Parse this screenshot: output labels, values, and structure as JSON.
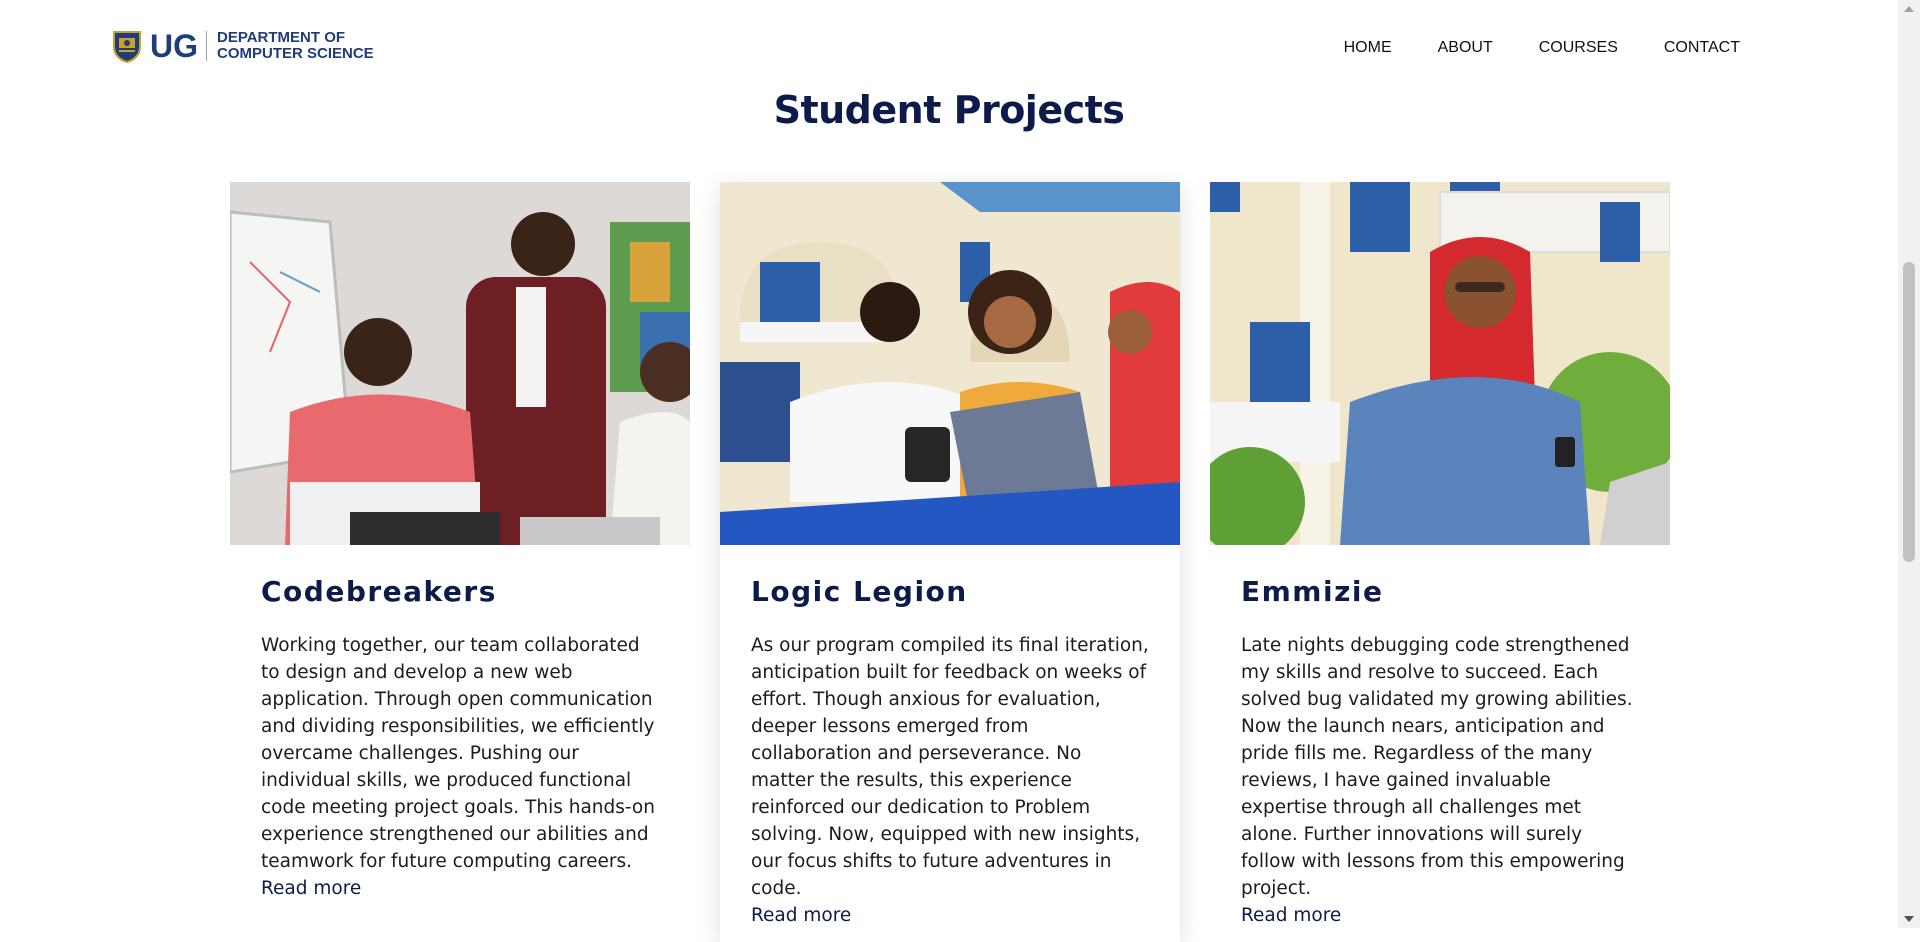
{
  "header": {
    "logo_ug": "UG",
    "logo_line1": "DEPARTMENT OF",
    "logo_line2": "COMPUTER SCIENCE",
    "nav": [
      "HOME",
      "ABOUT",
      "COURSES",
      "CONTACT"
    ]
  },
  "section": {
    "title": "Student Projects"
  },
  "projects": [
    {
      "title": "Codebreakers",
      "text": "Working together, our team collaborated to design and develop a new web application. Through open communication and dividing responsibilities, we efficiently overcame challenges. Pushing our individual skills, we produced functional code meeting project goals. This hands-on experience strengthened our abilities and teamwork for future computing careers.",
      "link": "Read more",
      "image": "students-collaborating-photo"
    },
    {
      "title": "Logic Legion",
      "text": "As our program compiled its final iteration, anticipation built for feedback on weeks of effort. Though anxious for evaluation, deeper lessons emerged from collaboration and perseverance. No matter the results, this experience reinforced our dedication to Problem solving. Now, equipped with new insights, our focus shifts to future adventures in code.",
      "link": "Read more",
      "image": "students-with-laptop-photo"
    },
    {
      "title": "Emmizie",
      "text": "Late nights debugging code strengthened my skills and resolve to succeed. Each solved bug validated my growing abilities. Now the launch nears, anticipation and pride fills me. Regardless of the many reviews, I have gained invaluable expertise through all challenges met alone. Further innovations will surely follow with lessons from this empowering project.",
      "link": "Read more",
      "image": "student-with-phone-photo"
    }
  ],
  "colors": {
    "brand": "#1f3d7a",
    "heading": "#0d1b4a"
  }
}
